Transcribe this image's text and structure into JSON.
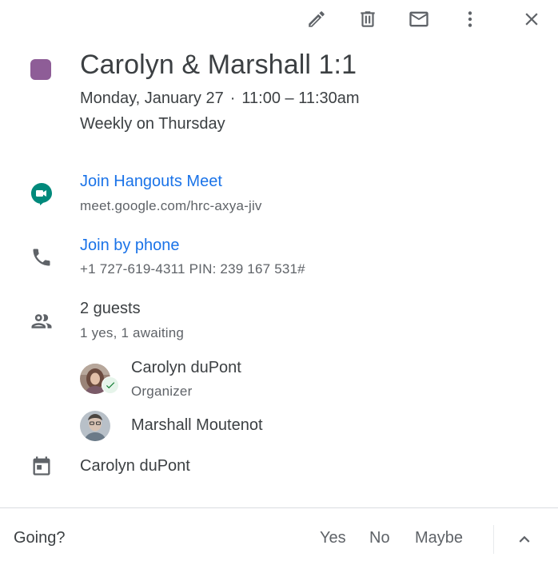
{
  "toolbar": {
    "edit_icon": "pencil-icon",
    "delete_icon": "trash-icon",
    "email_icon": "mail-icon",
    "more_icon": "more-vert-icon",
    "close_icon": "close-icon"
  },
  "event": {
    "color": "#8e5d97",
    "title": "Carolyn & Marshall 1:1",
    "date": "Monday, January 27",
    "separator": "·",
    "time": "11:00 – 11:30am",
    "recurrence": "Weekly on Thursday"
  },
  "conference": {
    "join_label": "Join Hangouts Meet",
    "url": "meet.google.com/hrc-axya-jiv"
  },
  "phone": {
    "join_label": "Join by phone",
    "number": "+1 727-619-4311 PIN: 239 167 531#"
  },
  "guests": {
    "count_label": "2 guests",
    "summary": "1 yes, 1 awaiting",
    "list": [
      {
        "name": "Carolyn duPont",
        "role": "Organizer",
        "status": "accepted"
      },
      {
        "name": "Marshall Moutenot",
        "role": ""
      }
    ]
  },
  "calendar": {
    "owner": "Carolyn duPont"
  },
  "footer": {
    "prompt": "Going?",
    "yes": "Yes",
    "no": "No",
    "maybe": "Maybe"
  },
  "colors": {
    "accent_blue": "#1a73e8",
    "text_primary": "#3c4043",
    "text_secondary": "#5f6368",
    "accepted_green": "#188038"
  }
}
